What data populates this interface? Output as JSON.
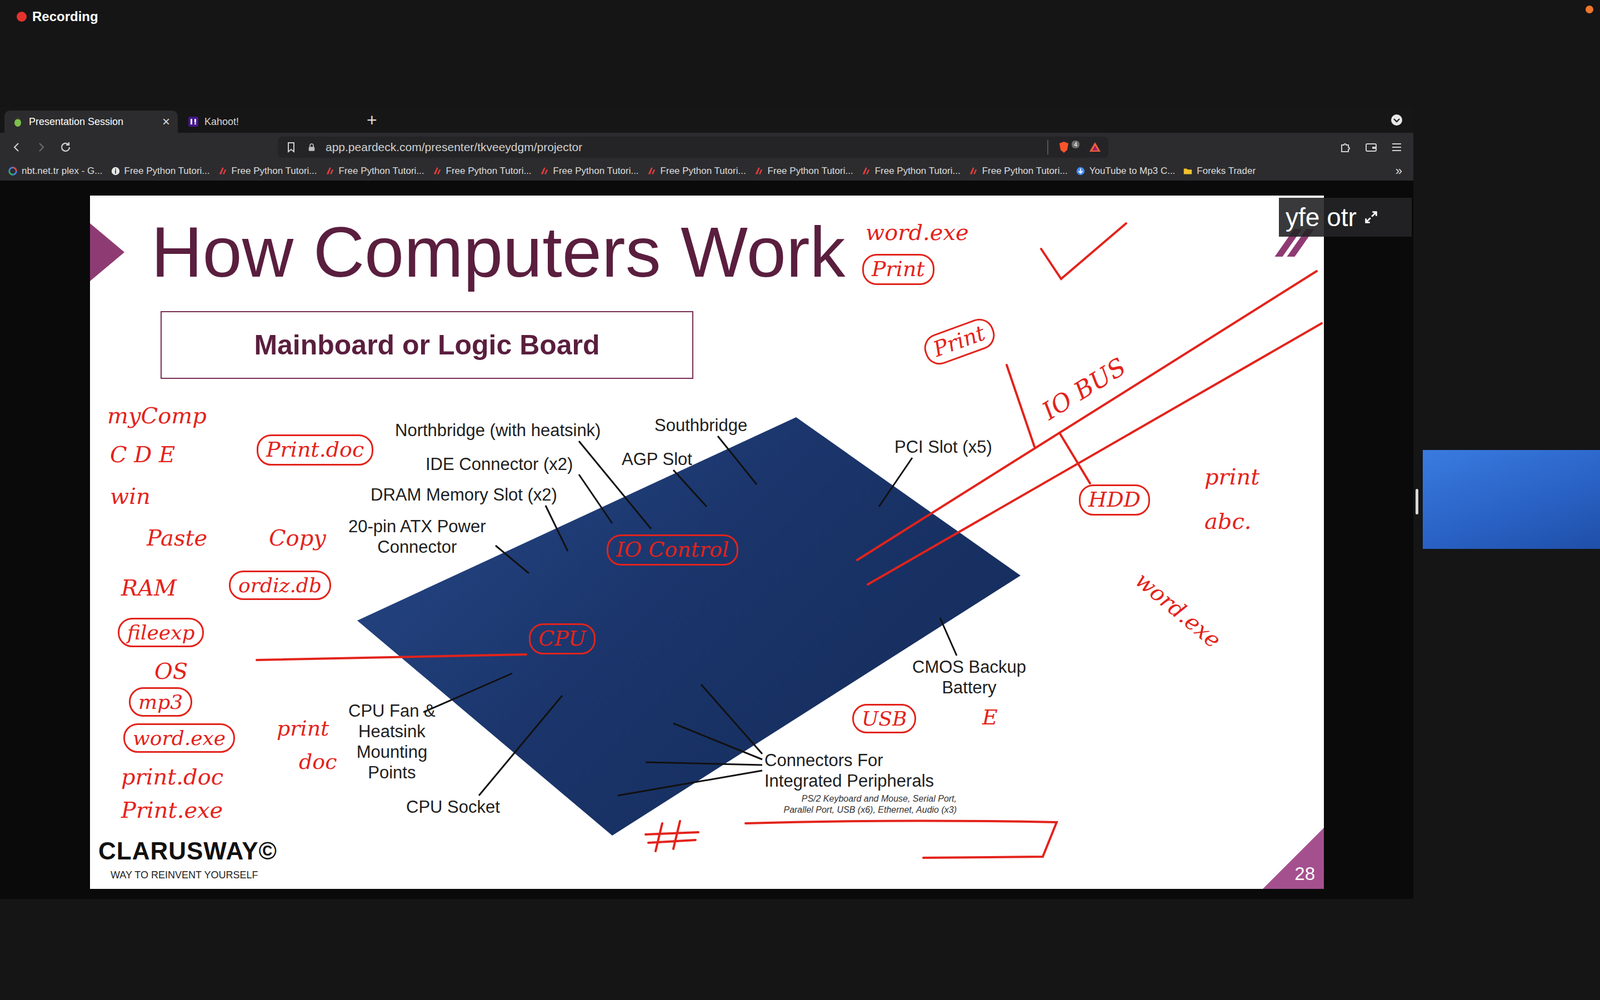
{
  "screen": {
    "recording": "Recording"
  },
  "browser": {
    "tabs": [
      {
        "label": "Presentation Session",
        "selected": true,
        "close": "×",
        "kind": "peardeck"
      },
      {
        "label": "Kahoot!",
        "selected": false,
        "kind": "kahoot"
      }
    ],
    "new_tab": "+",
    "address": {
      "url": "app.peardeck.com/presenter/tkveeydgm/projector",
      "shield_count": "4"
    },
    "bookmarks": [
      {
        "label": "nbt.net.tr plex - G...",
        "kind": "google"
      },
      {
        "label": "Free Python Tutori...",
        "kind": "info"
      },
      {
        "label": "Free Python Tutori...",
        "kind": "clarusway"
      },
      {
        "label": "Free Python Tutori...",
        "kind": "clarusway"
      },
      {
        "label": "Free Python Tutori...",
        "kind": "clarusway"
      },
      {
        "label": "Free Python Tutori...",
        "kind": "clarusway"
      },
      {
        "label": "Free Python Tutori...",
        "kind": "clarusway"
      },
      {
        "label": "Free Python Tutori...",
        "kind": "clarusway"
      },
      {
        "label": "Free Python Tutori...",
        "kind": "clarusway"
      },
      {
        "label": "Free Python Tutori...",
        "kind": "clarusway"
      },
      {
        "label": "YouTube to Mp3 C...",
        "kind": "download"
      },
      {
        "label": "Foreks Trader",
        "kind": "folder"
      }
    ],
    "bookmarks_more": "»"
  },
  "slide": {
    "title": "How Computers Work",
    "subtitle": "Mainboard or Logic Board",
    "labels": [
      {
        "lines": [
          "Northbridge (with heatsink)"
        ]
      },
      {
        "lines": [
          "Southbridge"
        ]
      },
      {
        "lines": [
          "IDE Connector (x2)"
        ]
      },
      {
        "lines": [
          "AGP Slot"
        ]
      },
      {
        "lines": [
          "PCI Slot (x5)"
        ]
      },
      {
        "lines": [
          "DRAM Memory Slot (x2)"
        ]
      },
      {
        "lines": [
          "20-pin ATX Power",
          "Connector"
        ]
      },
      {
        "lines": [
          "CMOS Backup",
          "Battery"
        ]
      },
      {
        "lines": [
          "CPU Fan &",
          "Heatsink",
          "Mounting",
          "Points"
        ]
      },
      {
        "lines": [
          "CPU Socket"
        ]
      },
      {
        "lines": [
          "Connectors For",
          "Integrated Peripherals"
        ]
      }
    ],
    "footnote": [
      "PS/2 Keyboard and Mouse, Serial Port,",
      "Parallel Port, USB (x6), Ethernet, Audio (x3)"
    ],
    "brand": "CLARUSWAY©",
    "tagline": "WAY TO REINVENT YOURSELF",
    "page": "28"
  },
  "presenter": {
    "name": "yfe otr"
  },
  "annotations": [
    {
      "text": "word.exe"
    },
    {
      "text": "Print"
    },
    {
      "text": "myComp"
    },
    {
      "text": "C D E"
    },
    {
      "text": "win"
    },
    {
      "text": "Print.doc"
    },
    {
      "text": "Paste"
    },
    {
      "text": "Copy"
    },
    {
      "text": "RAM"
    },
    {
      "text": "ordiz.db"
    },
    {
      "text": "fileexp"
    },
    {
      "text": "OS"
    },
    {
      "text": "mp3"
    },
    {
      "text": "word.exe"
    },
    {
      "text": "print"
    },
    {
      "text": "doc"
    },
    {
      "text": "print.doc"
    },
    {
      "text": "Print.exe"
    },
    {
      "text": "IO Control"
    },
    {
      "text": "CPU"
    },
    {
      "text": "USB"
    },
    {
      "text": "E"
    },
    {
      "text": "Print"
    },
    {
      "text": "IO BUS"
    },
    {
      "text": "HDD"
    },
    {
      "text": "print"
    },
    {
      "text": "abc."
    },
    {
      "text": "word.exe"
    }
  ]
}
